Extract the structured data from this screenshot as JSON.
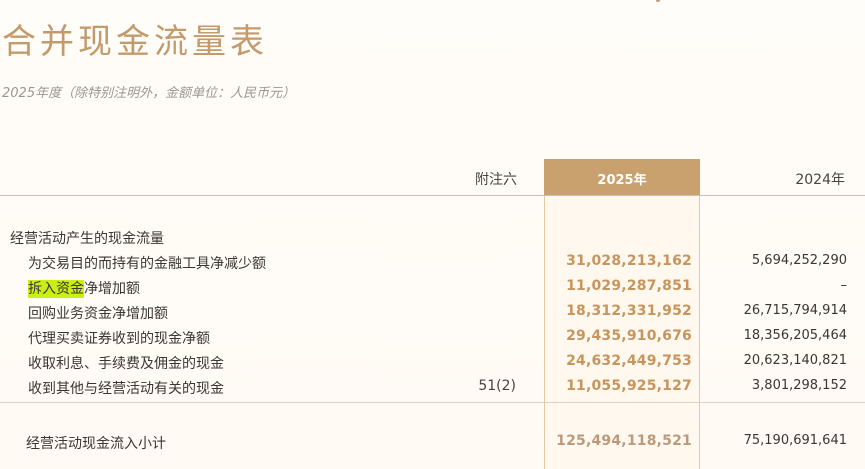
{
  "title": "合并现金流量表",
  "subtitle": "2025年度（除特别注明外，金额单位：人民币元）",
  "header": {
    "note": "附注六",
    "y2025": "2025年",
    "y2024": "2024年"
  },
  "section_title": "经营活动产生的现金流量",
  "rows": [
    {
      "label": "为交易目的而持有的金融工具净减少额",
      "note": "",
      "v2025": "31,028,213,162",
      "v2024": "5,694,252,290"
    },
    {
      "label_highlight": "拆入资金",
      "label_rest": "净增加额",
      "note": "",
      "v2025": "11,029,287,851",
      "v2024": "–"
    },
    {
      "label": "回购业务资金净增加额",
      "note": "",
      "v2025": "18,312,331,952",
      "v2024": "26,715,794,914"
    },
    {
      "label": "代理买卖证券收到的现金净额",
      "note": "",
      "v2025": "29,435,910,676",
      "v2024": "18,356,205,464"
    },
    {
      "label": "收取利息、手续费及佣金的现金",
      "note": "",
      "v2025": "24,632,449,753",
      "v2024": "20,623,140,821"
    },
    {
      "label": "收到其他与经营活动有关的现金",
      "note": "51(2)",
      "v2025": "11,055,925,127",
      "v2024": "3,801,298,152"
    }
  ],
  "subtotal": {
    "label": "经营活动现金流入小计",
    "v2025": "125,494,118,521",
    "v2024": "75,190,691,641"
  },
  "colors": {
    "accent": "#c39a6b",
    "header_fill": "#c9a16f",
    "value_2025": "#c7955c",
    "highlight": "#c9f012"
  }
}
